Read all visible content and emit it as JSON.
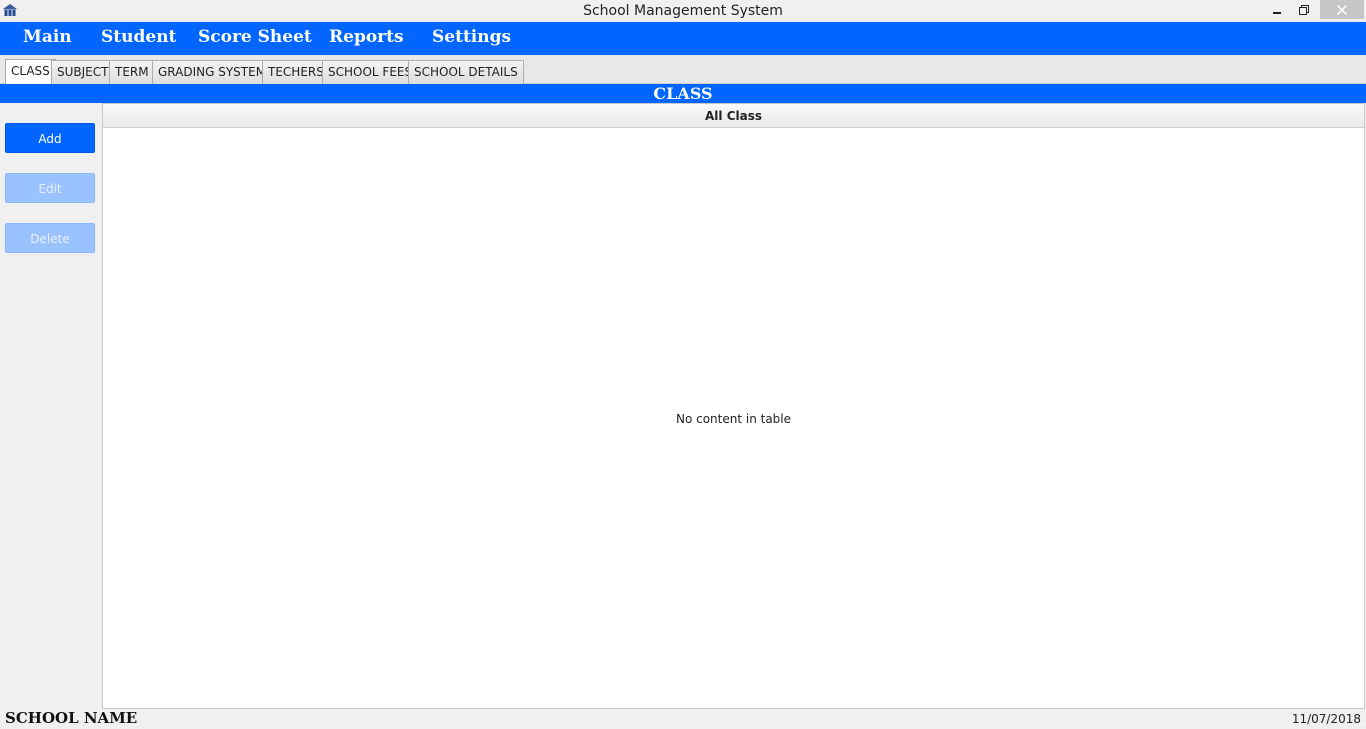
{
  "window": {
    "title": "School Management System",
    "icon": "school-building-icon"
  },
  "menu": {
    "items": [
      "Main",
      "Student",
      "Score Sheet",
      "Reports",
      "Settings"
    ]
  },
  "tabs": {
    "items": [
      "CLASS",
      "SUBJECT",
      "TERM",
      "GRADING SYSTEM",
      "TECHERS",
      "SCHOOL FEES",
      "SCHOOL DETAILS"
    ],
    "active": "CLASS"
  },
  "section": {
    "title": "CLASS"
  },
  "actions": {
    "add": "Add",
    "edit": "Edit",
    "delete": "Delete"
  },
  "table": {
    "column": "All Class",
    "empty_text": "No content in table"
  },
  "status": {
    "school_name": "SCHOOL NAME",
    "date": "11/07/2018"
  },
  "colors": {
    "accent": "#0066ff",
    "disabled_button": "#99c2ff"
  }
}
